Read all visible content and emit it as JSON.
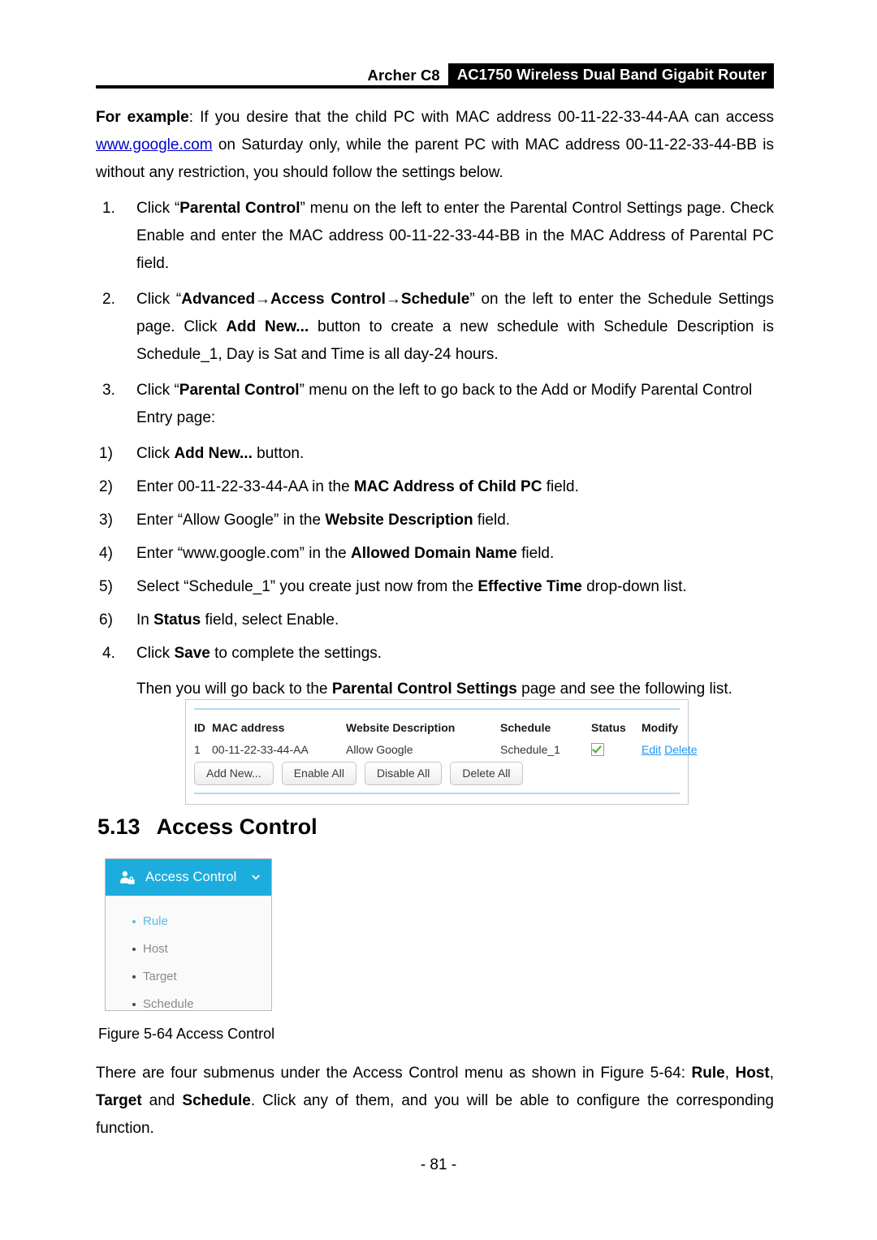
{
  "header": {
    "model": "Archer C8",
    "product": "AC1750 Wireless Dual Band Gigabit Router"
  },
  "intro": {
    "label": "For example",
    "part1": ": If you desire that the child PC with MAC address 00-11-22-33-44-AA can access ",
    "link": "www.google.com",
    "part2": " on Saturday only, while the parent PC with MAC address 00-11-22-33-44-BB is without any restriction, you should follow the settings below."
  },
  "steps": [
    {
      "marker": "1.",
      "segments": [
        {
          "text": "Click “",
          "bold": false
        },
        {
          "text": "Parental Control",
          "bold": true
        },
        {
          "text": "” menu on the left to enter the Parental Control Settings page. Check Enable and enter the MAC address 00-11-22-33-44-BB in the MAC Address of Parental PC field.",
          "bold": false
        }
      ]
    },
    {
      "marker": "2.",
      "segments": [
        {
          "text": "Click “",
          "bold": false
        },
        {
          "text": "Advanced→Access Control→Schedule",
          "bold": true
        },
        {
          "text": "” on the left to enter the Schedule Settings page. Click ",
          "bold": false
        },
        {
          "text": "Add New...",
          "bold": true
        },
        {
          "text": " button to create a new schedule with Schedule Description is Schedule_1, Day is Sat and Time is all day-24 hours.",
          "bold": false
        }
      ]
    },
    {
      "marker": "3.",
      "segments": [
        {
          "text": "Click “",
          "bold": false
        },
        {
          "text": "Parental Control",
          "bold": true
        },
        {
          "text": "” menu on the left to go back to the Add or Modify Parental Control Entry page:",
          "bold": false
        }
      ]
    }
  ],
  "substeps": [
    {
      "marker": "1)",
      "segments": [
        {
          "text": "Click ",
          "bold": false
        },
        {
          "text": "Add New...",
          "bold": true
        },
        {
          "text": " button.",
          "bold": false
        }
      ]
    },
    {
      "marker": "2)",
      "segments": [
        {
          "text": "Enter 00-11-22-33-44-AA in the ",
          "bold": false
        },
        {
          "text": "MAC Address of Child PC",
          "bold": true
        },
        {
          "text": " field.",
          "bold": false
        }
      ]
    },
    {
      "marker": "3)",
      "segments": [
        {
          "text": "Enter “Allow Google” in the ",
          "bold": false
        },
        {
          "text": "Website Description",
          "bold": true
        },
        {
          "text": " field.",
          "bold": false
        }
      ]
    },
    {
      "marker": "4)",
      "segments": [
        {
          "text": "Enter “www.google.com” in the ",
          "bold": false
        },
        {
          "text": "Allowed Domain Name",
          "bold": true
        },
        {
          "text": " field.",
          "bold": false
        }
      ]
    },
    {
      "marker": "5)",
      "segments": [
        {
          "text": "Select “Schedule_1” you create just now from the ",
          "bold": false
        },
        {
          "text": "Effective Time",
          "bold": true
        },
        {
          "text": " drop-down list.",
          "bold": false
        }
      ]
    },
    {
      "marker": "6)",
      "segments": [
        {
          "text": "In ",
          "bold": false
        },
        {
          "text": "Status",
          "bold": true
        },
        {
          "text": " field, select Enable.",
          "bold": false
        }
      ]
    }
  ],
  "step4": {
    "marker": "4.",
    "segments": [
      {
        "text": "Click ",
        "bold": false
      },
      {
        "text": "Save",
        "bold": true
      },
      {
        "text": " to complete the settings.",
        "bold": false
      }
    ]
  },
  "after_note": {
    "segments": [
      {
        "text": "Then you will go back to the ",
        "bold": false
      },
      {
        "text": "Parental Control Settings",
        "bold": true
      },
      {
        "text": " page and see the following list.",
        "bold": false
      }
    ]
  },
  "figure_table": {
    "columns": [
      "ID",
      "MAC address",
      "Website Description",
      "Schedule",
      "Status",
      "Modify"
    ],
    "rows": [
      {
        "id": "1",
        "mac": "00-11-22-33-44-AA",
        "description": "Allow Google",
        "schedule": "Schedule_1",
        "status_checked": true,
        "edit_label": "Edit",
        "delete_label": "Delete"
      }
    ],
    "buttons": [
      "Add New...",
      "Enable All",
      "Disable All",
      "Delete All"
    ],
    "colors": {
      "rule_line": "#b7d9ef",
      "link": "#2196f3",
      "check": "#4aa832"
    }
  },
  "section": {
    "number": "5.13",
    "title": "Access Control"
  },
  "access_menu": {
    "icon": "user-lock-icon",
    "title": "Access Control",
    "chevron": "chevron-down-icon",
    "accent": "#1cadde",
    "items": [
      {
        "label": "Rule",
        "active": true
      },
      {
        "label": "Host",
        "active": false
      },
      {
        "label": "Target",
        "active": false
      },
      {
        "label": "Schedule",
        "active": false
      }
    ]
  },
  "figure_caption": "Figure 5-64 Access Control",
  "closing": {
    "segments": [
      {
        "text": "There are four submenus under the Access Control menu as shown in Figure 5-64: ",
        "bold": false
      },
      {
        "text": "Rule",
        "bold": true
      },
      {
        "text": ", ",
        "bold": false
      },
      {
        "text": "Host",
        "bold": true
      },
      {
        "text": ", ",
        "bold": false
      },
      {
        "text": "Target",
        "bold": true
      },
      {
        "text": " and ",
        "bold": false
      },
      {
        "text": "Schedule",
        "bold": true
      },
      {
        "text": ". Click any of them, and you will be able to configure the corresponding function.",
        "bold": false
      }
    ]
  },
  "page_number": "- 81 -"
}
